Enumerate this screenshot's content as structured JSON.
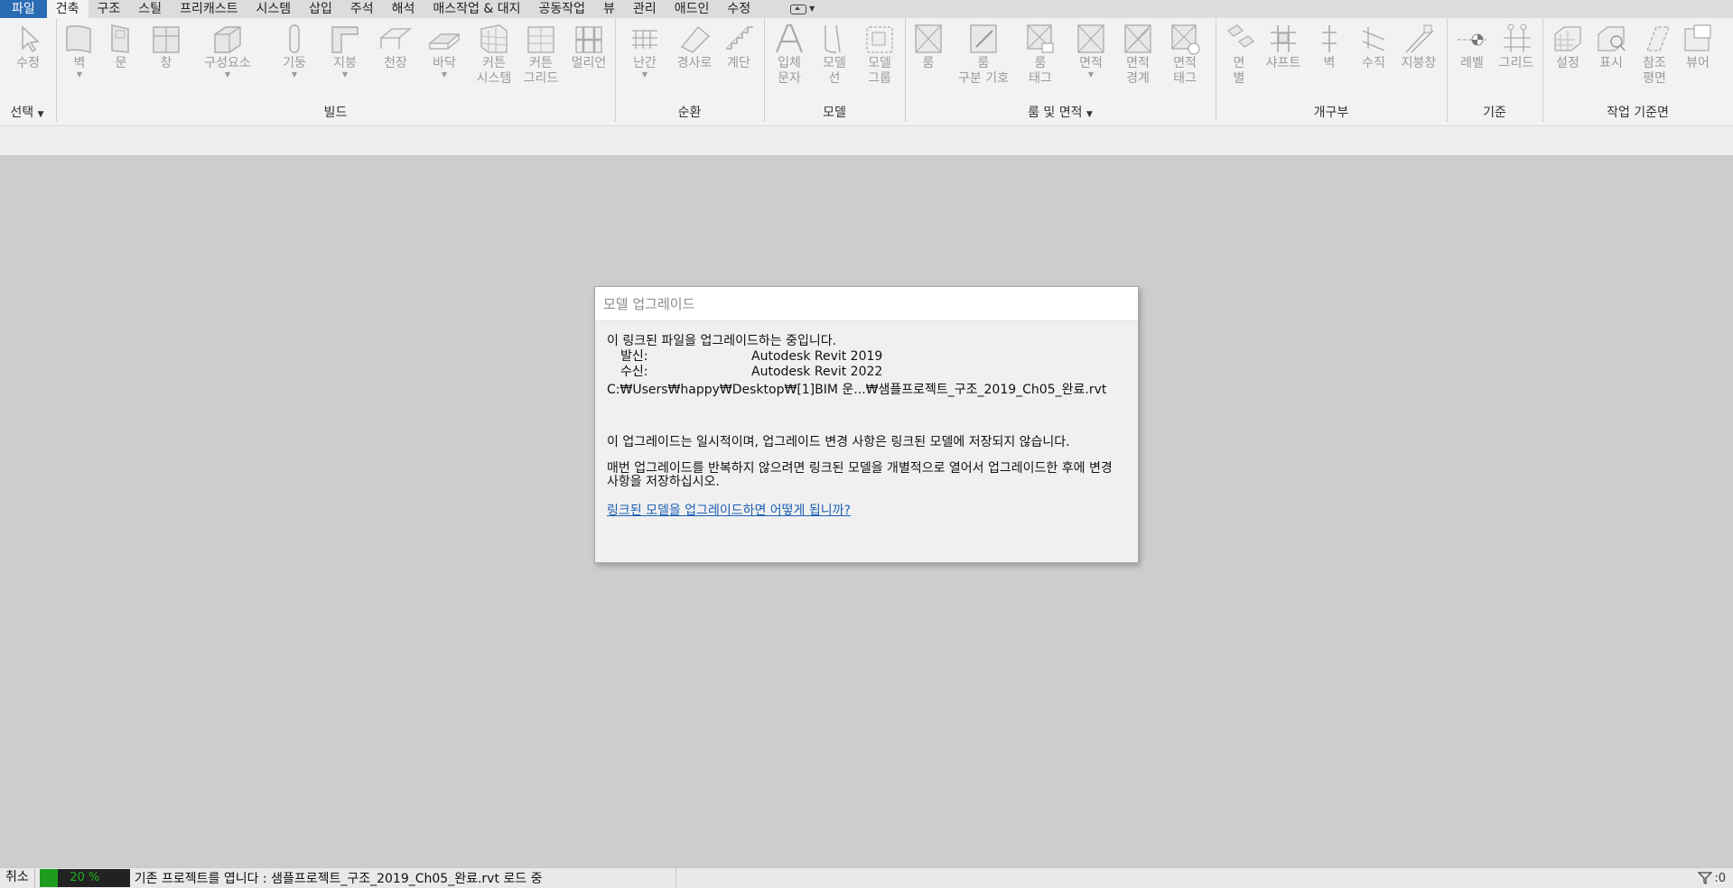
{
  "tabs": [
    "파일",
    "건축",
    "구조",
    "스틸",
    "프리캐스트",
    "시스템",
    "삽입",
    "주석",
    "해석",
    "매스작업 & 대지",
    "공동작업",
    "뷰",
    "관리",
    "애드인",
    "수정"
  ],
  "active_tab": "건축",
  "ribbon": {
    "tools": {
      "modify": "수정",
      "wall": "벽",
      "door": "문",
      "window": "창",
      "component": "구성요소",
      "column": "기둥",
      "roof": "지붕",
      "ceiling": "천장",
      "floor": "바닥",
      "curtain_system": "커튼\n시스템",
      "curtain_grid": "커튼\n그리드",
      "mullion": "멀리언",
      "railing": "난간",
      "ramp": "경사로",
      "stair": "계단",
      "model_text": "입체\n문자",
      "model_line": "모델\n선",
      "model_group": "모델\n그룹",
      "room": "룸",
      "room_separator": "룸\n구분 기호",
      "room_tag": "룸\n태그",
      "area": "면적",
      "area_boundary": "면적\n경계",
      "area_tag": "면적\n태그",
      "by_face": "면\n별",
      "shaft": "샤프트",
      "opening_wall": "벽",
      "vertical": "수직",
      "dormer": "지붕창",
      "level": "레벨",
      "grid": "그리드",
      "set": "설정",
      "show": "표시",
      "ref_plane": "참조\n평면",
      "viewer": "뷰어"
    },
    "panels": {
      "select": "선택",
      "build": "빌드",
      "circulation": "순환",
      "model": "모델",
      "room_area": "룸 및 면적",
      "opening": "개구부",
      "datum": "기준",
      "work_plane": "작업 기준면"
    }
  },
  "dialog": {
    "title": "모델 업그레이드",
    "line1": "이 링크된 파일을 업그레이드하는 중입니다.",
    "from_label": "발신:",
    "from_value": "Autodesk Revit 2019",
    "to_label": "수신:",
    "to_value": "Autodesk Revit 2022",
    "path": "C:₩Users₩happy₩Desktop₩[1]BIM 운...₩샘플프로젝트_구조_2019_Ch05_완료.rvt",
    "para1": "이 업그레이드는 일시적이며, 업그레이드 변경 사항은 링크된 모델에 저장되지 않습니다.",
    "para2": "매번 업그레이드를 반복하지 않으려면 링크된 모델을 개별적으로 열어서 업그레이드한 후에 변경 사항을 저장하십시오.",
    "link": "링크된 모델을 업그레이드하면 어떻게 됩니까?"
  },
  "status": {
    "cancel": "취소",
    "progress_text": "20 %",
    "progress": 0.2,
    "message": "기존 프로젝트를 엽니다 : 샘플프로젝트_구조_2019_Ch05_완료.rvt 로드 중",
    "filter_count": ":0"
  },
  "colors": {
    "file_tab": "#2a6cb4",
    "progress_fill": "#1d9c1d",
    "link": "#1a5fb4"
  }
}
